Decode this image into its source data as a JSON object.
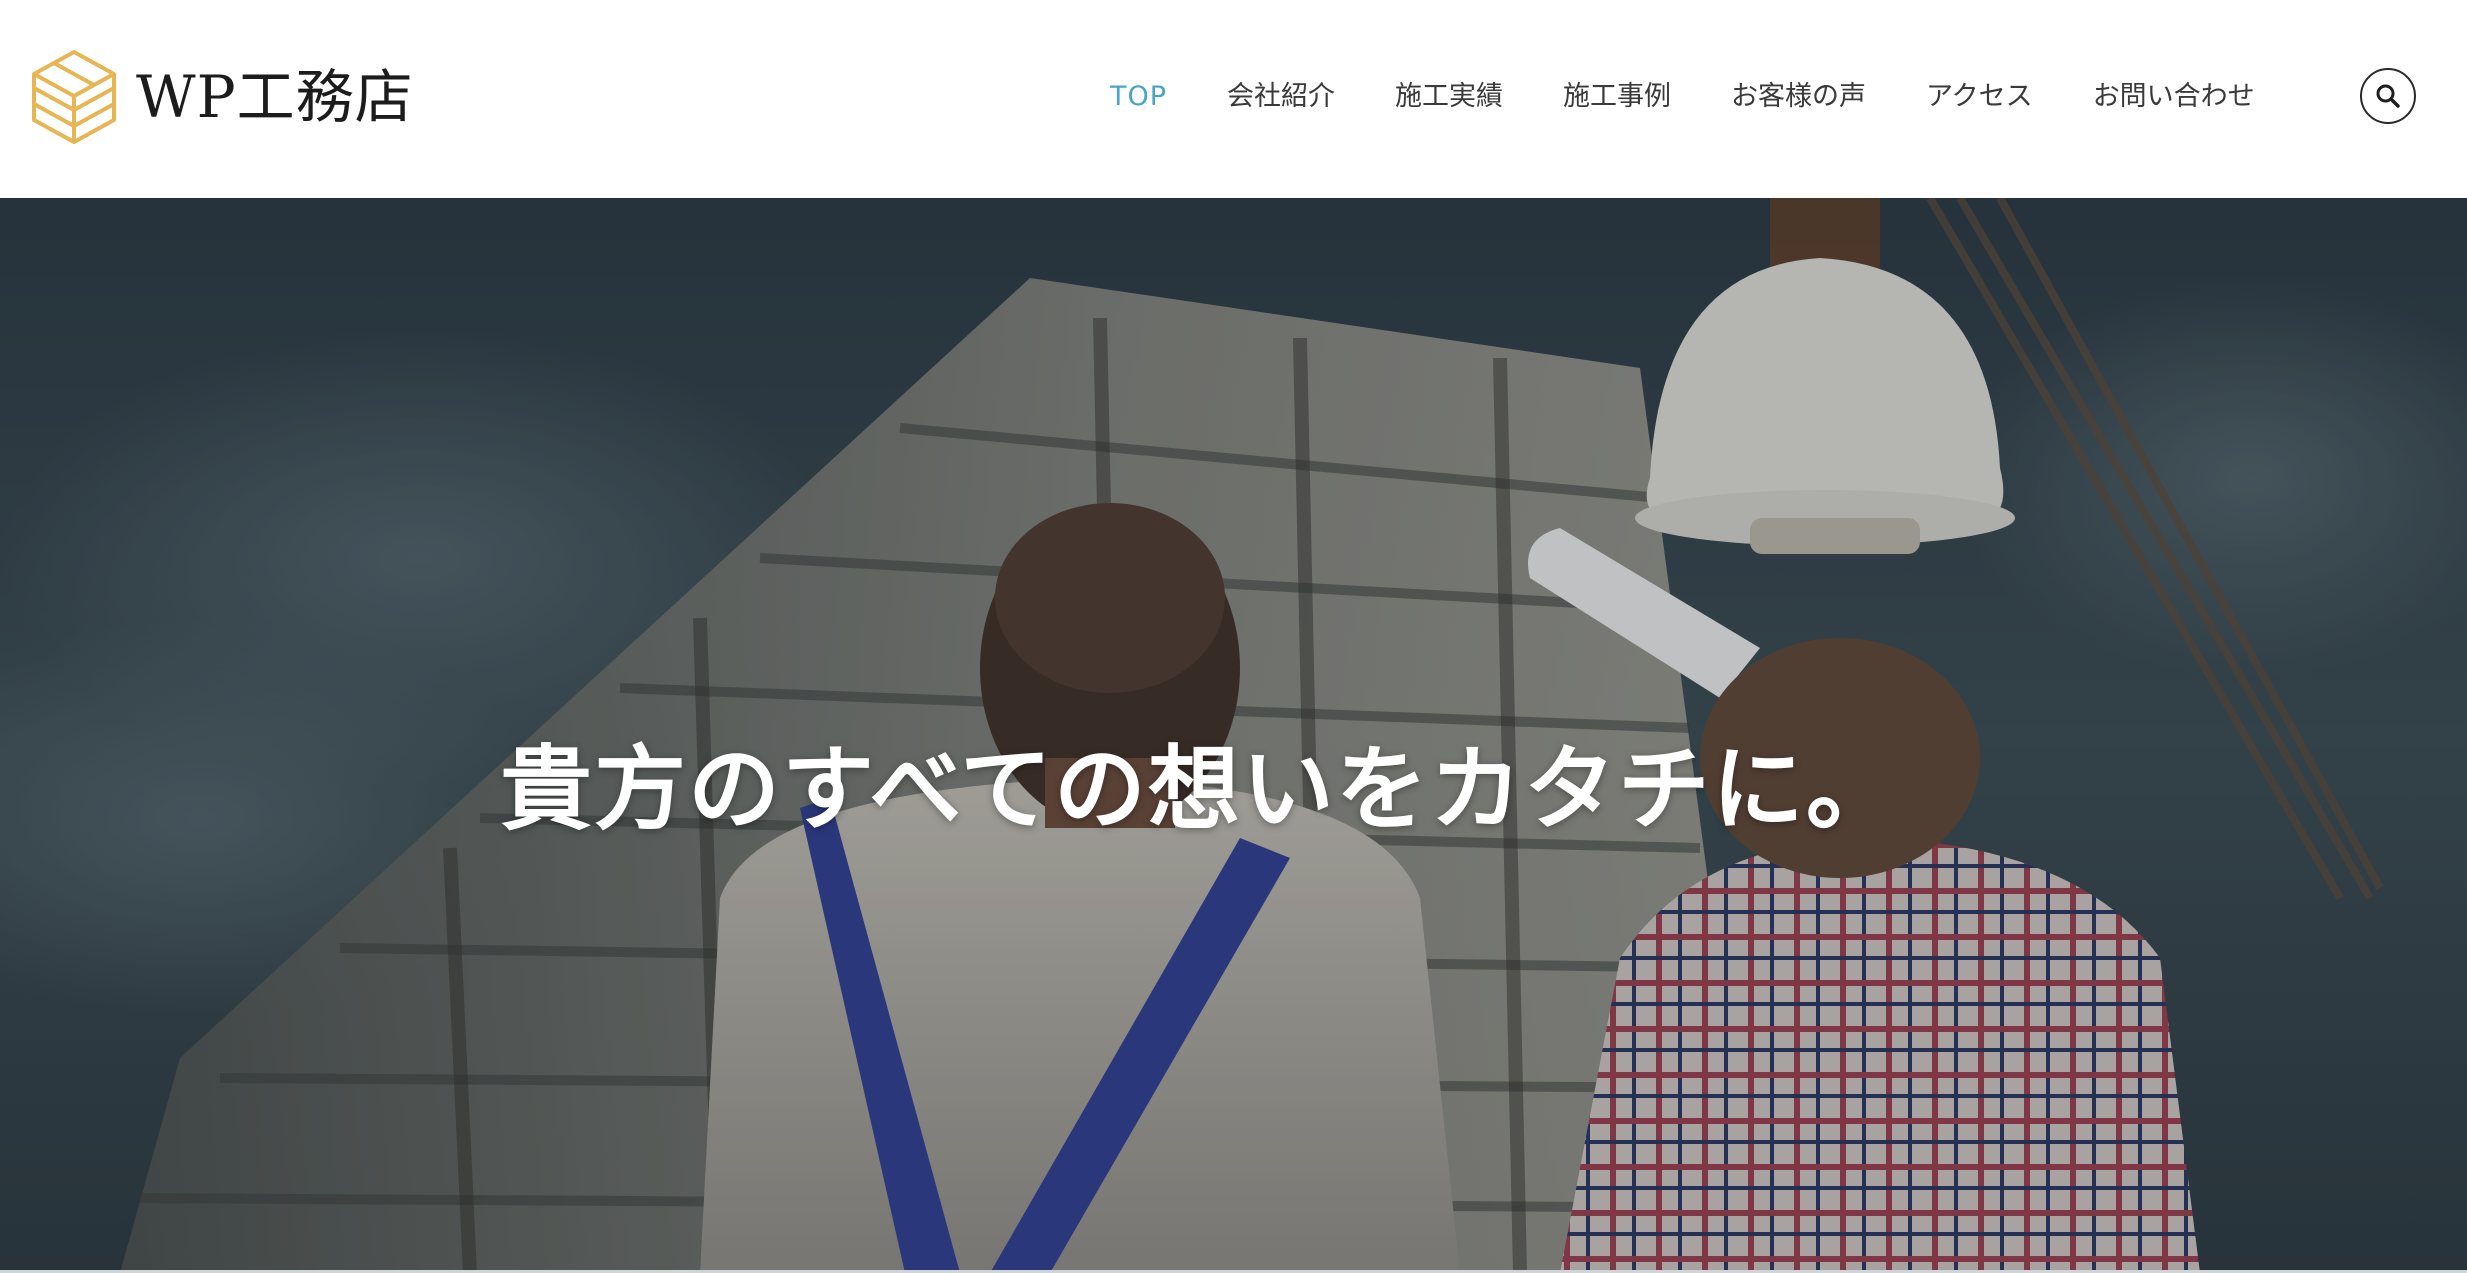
{
  "header": {
    "logo_text": "WP工務店",
    "logo_icon": "isometric-stacked-cube-icon",
    "brand_color": "#e7b552"
  },
  "nav": {
    "items": [
      {
        "label": "TOP",
        "active": true
      },
      {
        "label": "会社紹介",
        "active": false
      },
      {
        "label": "施工実績",
        "active": false
      },
      {
        "label": "施工事例",
        "active": false
      },
      {
        "label": "お客様の声",
        "active": false
      },
      {
        "label": "アクセス",
        "active": false
      },
      {
        "label": "お問い合わせ",
        "active": false
      }
    ],
    "active_color": "#4aa3c9",
    "search_icon": "search-icon"
  },
  "hero": {
    "title": "貴方のすべての想いをカタチに。",
    "image": "construction-workers-building-photo"
  }
}
